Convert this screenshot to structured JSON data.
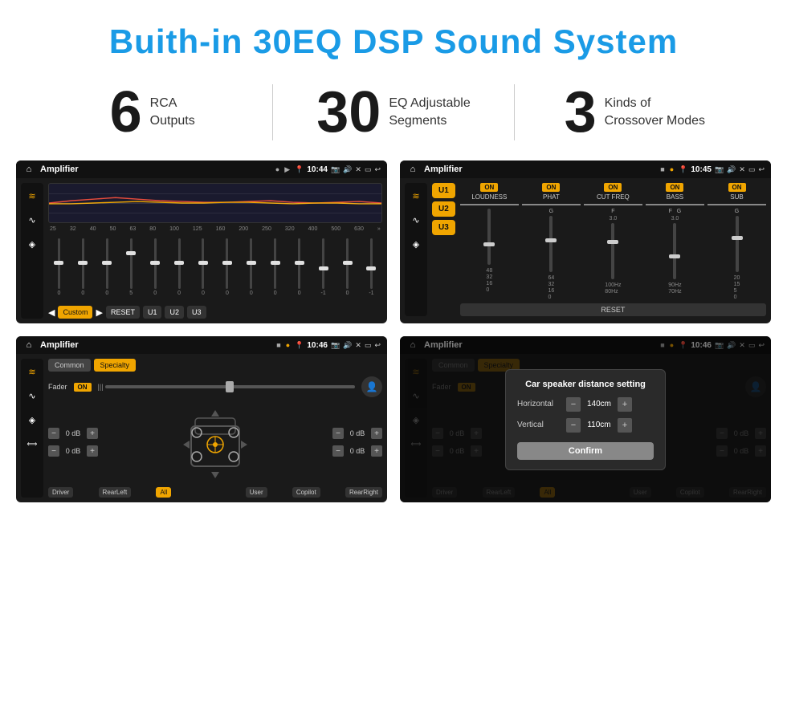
{
  "header": {
    "title": "Buith-in 30EQ DSP Sound System"
  },
  "stats": [
    {
      "number": "6",
      "label": "RCA\nOutputs"
    },
    {
      "number": "30",
      "label": "EQ Adjustable\nSegments"
    },
    {
      "number": "3",
      "label": "Kinds of\nCrossover Modes"
    }
  ],
  "screens": {
    "eq_screen": {
      "title": "Amplifier",
      "time": "10:44",
      "freq_labels": [
        "25",
        "32",
        "40",
        "50",
        "63",
        "80",
        "100",
        "125",
        "160",
        "200",
        "250",
        "320",
        "400",
        "500",
        "630"
      ],
      "slider_values": [
        "0",
        "0",
        "0",
        "5",
        "0",
        "0",
        "0",
        "0",
        "0",
        "0",
        "0",
        "-1",
        "0",
        "-1"
      ],
      "controls": [
        "Custom",
        "RESET",
        "U1",
        "U2",
        "U3"
      ]
    },
    "amp_screen": {
      "title": "Amplifier",
      "time": "10:45",
      "presets": [
        "U1",
        "U2",
        "U3"
      ],
      "channels": [
        "LOUDNESS",
        "PHAT",
        "CUT FREQ",
        "BASS",
        "SUB"
      ],
      "reset": "RESET"
    },
    "fader_screen": {
      "title": "Amplifier",
      "time": "10:46",
      "tabs": [
        "Common",
        "Specialty"
      ],
      "fader_label": "Fader",
      "db_values": [
        "0 dB",
        "0 dB",
        "0 dB",
        "0 dB"
      ],
      "labels": [
        "Driver",
        "RearLeft",
        "All",
        "Copilot",
        "RearRight",
        "User"
      ]
    },
    "dialog_screen": {
      "title": "Amplifier",
      "time": "10:46",
      "dialog": {
        "title": "Car speaker distance setting",
        "horizontal_label": "Horizontal",
        "horizontal_value": "140cm",
        "vertical_label": "Vertical",
        "vertical_value": "110cm",
        "confirm_label": "Confirm",
        "db_right_top": "0 dB",
        "db_right_bottom": "0 dB"
      },
      "labels": [
        "Driver",
        "RearLeft",
        "All",
        "Copilot",
        "RearRight",
        "User"
      ]
    }
  },
  "icons": {
    "home": "⌂",
    "pin": "📍",
    "speaker": "🔊",
    "back": "↩",
    "camera": "📷",
    "close": "✕",
    "minimize": "−",
    "eq_icon": "≋",
    "wave_icon": "∿",
    "speaker_icon": "▣",
    "up": "▲",
    "down": "▼",
    "left": "◀",
    "right": "▶",
    "play": "▶",
    "minus": "−",
    "plus": "+"
  },
  "colors": {
    "accent": "#f0a500",
    "bg_dark": "#1a1a1a",
    "bg_darker": "#111111",
    "text_light": "#ffffff",
    "text_dim": "#888888",
    "blue_title": "#1a9be6"
  }
}
